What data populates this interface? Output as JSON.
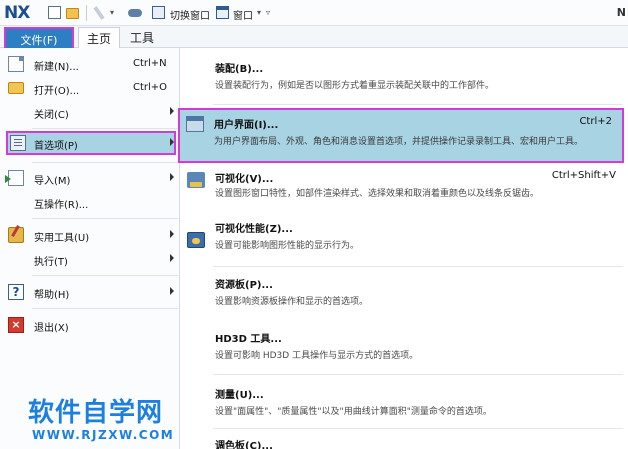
{
  "app": {
    "logo": "NX",
    "title_right": "N"
  },
  "quick_access": {
    "switch_window_label": "切换窗口",
    "window_label": "窗口",
    "window_caret": "▾",
    "overflow_caret": "▿",
    "edit_caret": "▾"
  },
  "tabs": [
    {
      "label": "文件(F)"
    },
    {
      "label": "主页"
    },
    {
      "label": "工具"
    }
  ],
  "file_menu": {
    "items": [
      {
        "label": "新建(N)...",
        "shortcut": "Ctrl+N",
        "icon": "new-document-icon"
      },
      {
        "label": "打开(O)...",
        "shortcut": "Ctrl+O",
        "icon": "open-folder-icon"
      },
      {
        "label": "关闭(C)",
        "shortcut": "",
        "icon": ""
      },
      {
        "label": "首选项(P)",
        "shortcut": "",
        "icon": "preferences-icon"
      },
      {
        "label": "导入(M)",
        "shortcut": "",
        "icon": "import-icon"
      },
      {
        "label": "互操作(R)...",
        "shortcut": "",
        "icon": ""
      },
      {
        "label": "实用工具(U)",
        "shortcut": "",
        "icon": "utilities-icon"
      },
      {
        "label": "执行(T)",
        "shortcut": "",
        "icon": ""
      },
      {
        "label": "帮助(H)",
        "shortcut": "",
        "icon": "help-icon"
      },
      {
        "label": "退出(X)",
        "shortcut": "",
        "icon": "exit-icon"
      }
    ]
  },
  "preferences_submenu": {
    "entries": [
      {
        "title": "装配(B)...",
        "desc": "设置装配行为，例如是否以图形方式着重显示装配关联中的工作部件。",
        "shortcut": ""
      },
      {
        "title": "用户界面(I)...",
        "desc": "为用户界面布局、外观、角色和消息设置首选项，并提供操作记录录制工具、宏和用户工具。",
        "shortcut": "Ctrl+2"
      },
      {
        "title": "可视化(V)...",
        "desc": "设置图形窗口特性，如部件渲染样式、选择效果和取消着重颜色以及线条反锯齿。",
        "shortcut": "Ctrl+Shift+V"
      },
      {
        "title": "可视化性能(Z)...",
        "desc": "设置可能影响图形性能的显示行为。",
        "shortcut": ""
      },
      {
        "title": "资源板(P)...",
        "desc": "设置影响资源板操作和显示的首选项。",
        "shortcut": ""
      },
      {
        "title": "HD3D 工具...",
        "desc": "设置可影响 HD3D 工具操作与显示方式的首选项。",
        "shortcut": ""
      },
      {
        "title": "测量(U)...",
        "desc": "设置\"面属性\"、\"质量属性\"以及\"用曲线计算面积\"测量命令的首选项。",
        "shortcut": ""
      },
      {
        "title": "调色板(C)...",
        "desc": "",
        "shortcut": ""
      }
    ]
  },
  "watermark": {
    "main": "软件自学网",
    "sub": "WWW.RJZXW.COM"
  },
  "colors": {
    "file_tab": "#2d7fc1",
    "selection": "#a8d3e3",
    "highlight_outline": "#d33bd6",
    "watermark": "#1d7fe0"
  }
}
